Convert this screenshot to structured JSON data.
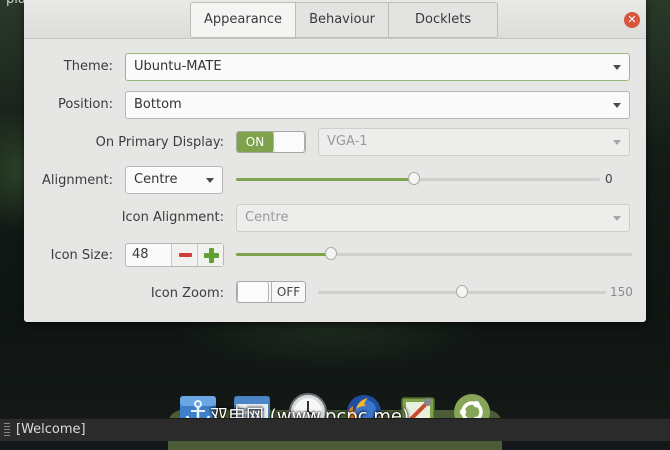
{
  "desktop": {
    "top_label": "plank"
  },
  "tabs": [
    {
      "label": "Appearance",
      "active": true
    },
    {
      "label": "Behaviour",
      "active": false
    },
    {
      "label": "Docklets",
      "active": false
    }
  ],
  "close_icon": "close-icon",
  "form": {
    "theme": {
      "label": "Theme:",
      "value": "Ubuntu-MATE"
    },
    "position": {
      "label": "Position:",
      "value": "Bottom"
    },
    "primary_display": {
      "label": "On Primary Display:",
      "toggle": "ON",
      "display_value": "VGA-1"
    },
    "alignment": {
      "label": "Alignment:",
      "value": "Centre",
      "offset_value": "0",
      "offset_fraction": 0.49
    },
    "icon_alignment": {
      "label": "Icon Alignment:",
      "value": "Centre"
    },
    "icon_size": {
      "label": "Icon Size:",
      "value": "48",
      "slider_fraction": 0.24
    },
    "icon_zoom": {
      "label": "Icon Zoom:",
      "toggle": "OFF",
      "value": "150",
      "slider_fraction": 0.5
    }
  },
  "dock": {
    "items": [
      "anchor-icon",
      "window-icon",
      "clock-icon",
      "firefox-icon",
      "settings-icon",
      "ubuntu-mate-icon"
    ],
    "watermark": "双电网 (www.pcpc.me)"
  },
  "panel": {
    "taskbar_item": "[Welcome]"
  },
  "colors": {
    "accent": "#7fa34d",
    "close": "#d9553b",
    "minus": "#d33b3b",
    "plus": "#5fa132"
  }
}
